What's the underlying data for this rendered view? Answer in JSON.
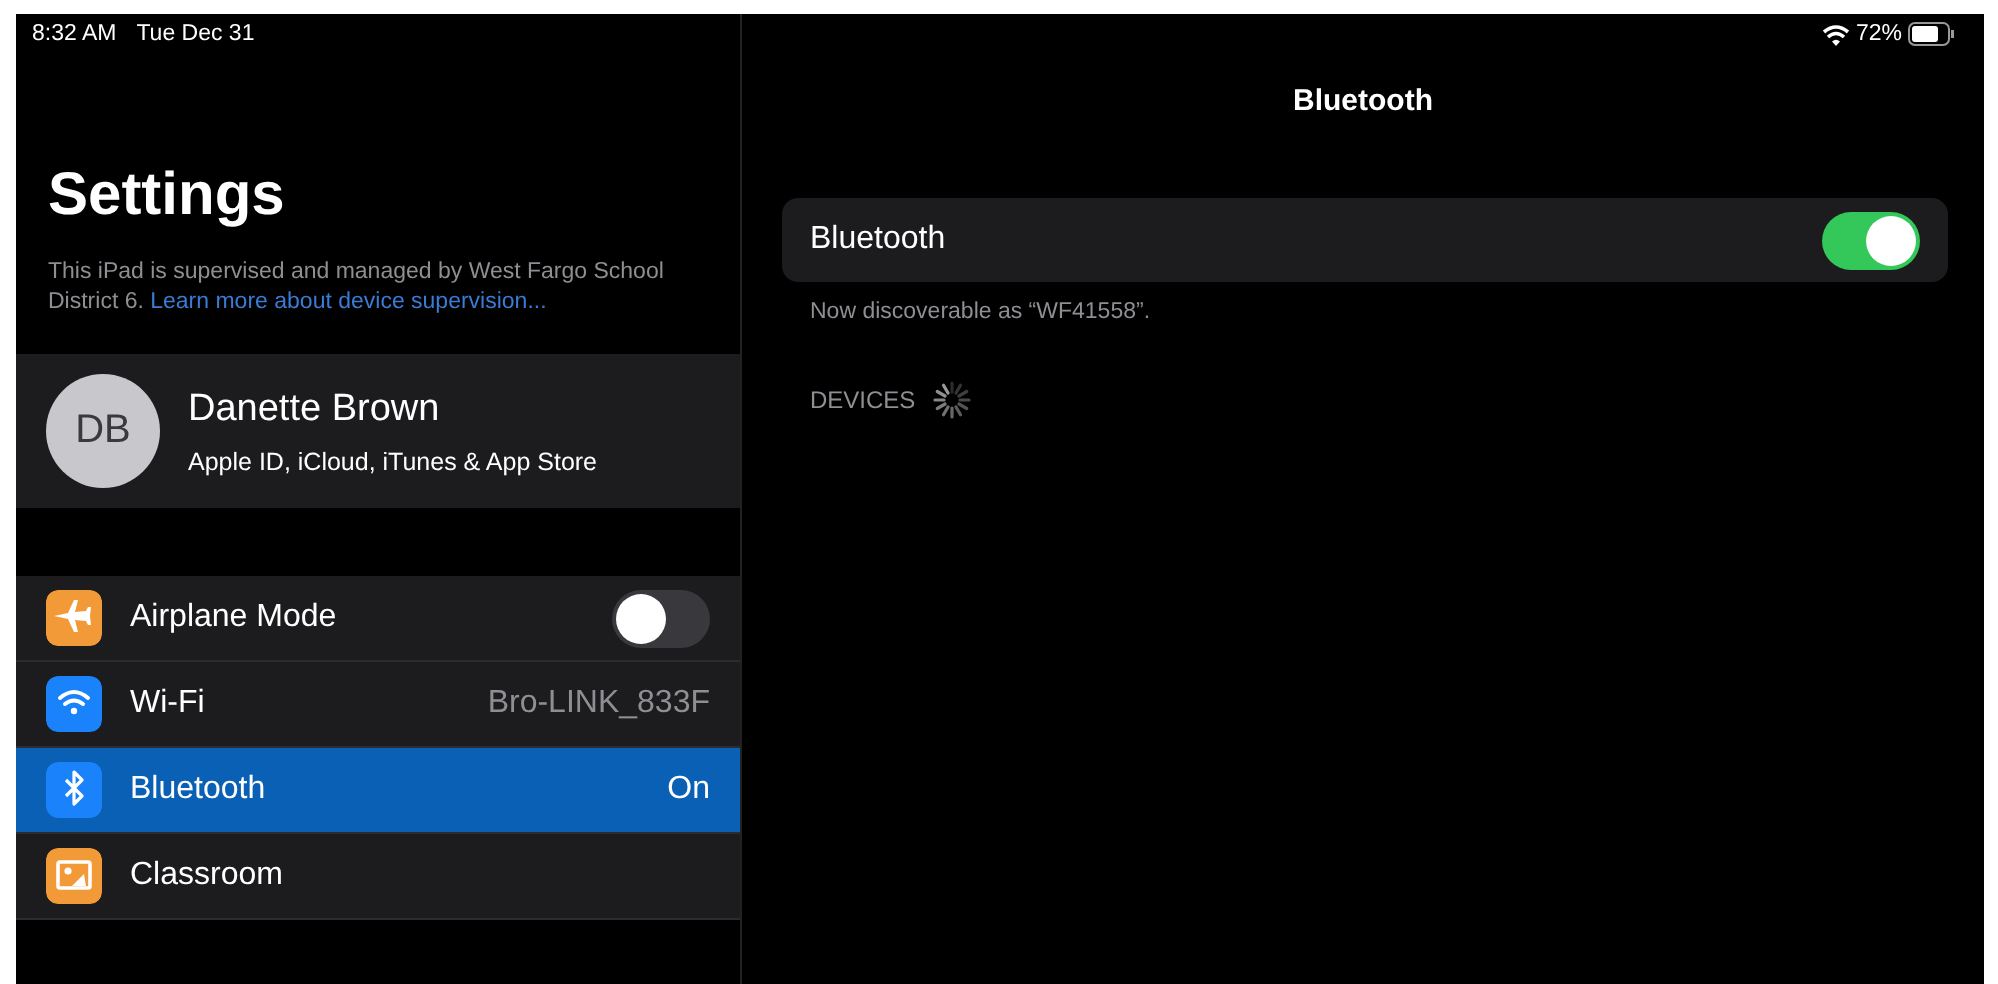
{
  "status_bar": {
    "time": "8:32 AM",
    "date": "Tue Dec 31",
    "battery_text": "72%"
  },
  "sidebar": {
    "title": "Settings",
    "supervision_note": "This iPad is supervised and managed by West Fargo School District 6.",
    "supervision_link": "Learn more about device supervision...",
    "profile": {
      "initials": "DB",
      "name": "Danette Brown",
      "subtitle": "Apple ID, iCloud, iTunes & App Store"
    },
    "items": [
      {
        "label": "Airplane Mode",
        "kind": "toggle",
        "on": false,
        "selected": false,
        "color": "#f19a37"
      },
      {
        "label": "Wi-Fi",
        "kind": "value",
        "value": "Bro-LINK_833F",
        "selected": false,
        "color": "#1a82fb"
      },
      {
        "label": "Bluetooth",
        "kind": "value",
        "value": "On",
        "selected": true,
        "color": "#1a82fb"
      },
      {
        "label": "Classroom",
        "kind": "plain",
        "selected": false,
        "color": "#f19a37"
      }
    ]
  },
  "detail": {
    "title": "Bluetooth",
    "setting": {
      "label": "Bluetooth",
      "on": true
    },
    "discoverable_note": "Now discoverable as “WF41558”.",
    "section_header": "DEVICES",
    "loading": true
  }
}
